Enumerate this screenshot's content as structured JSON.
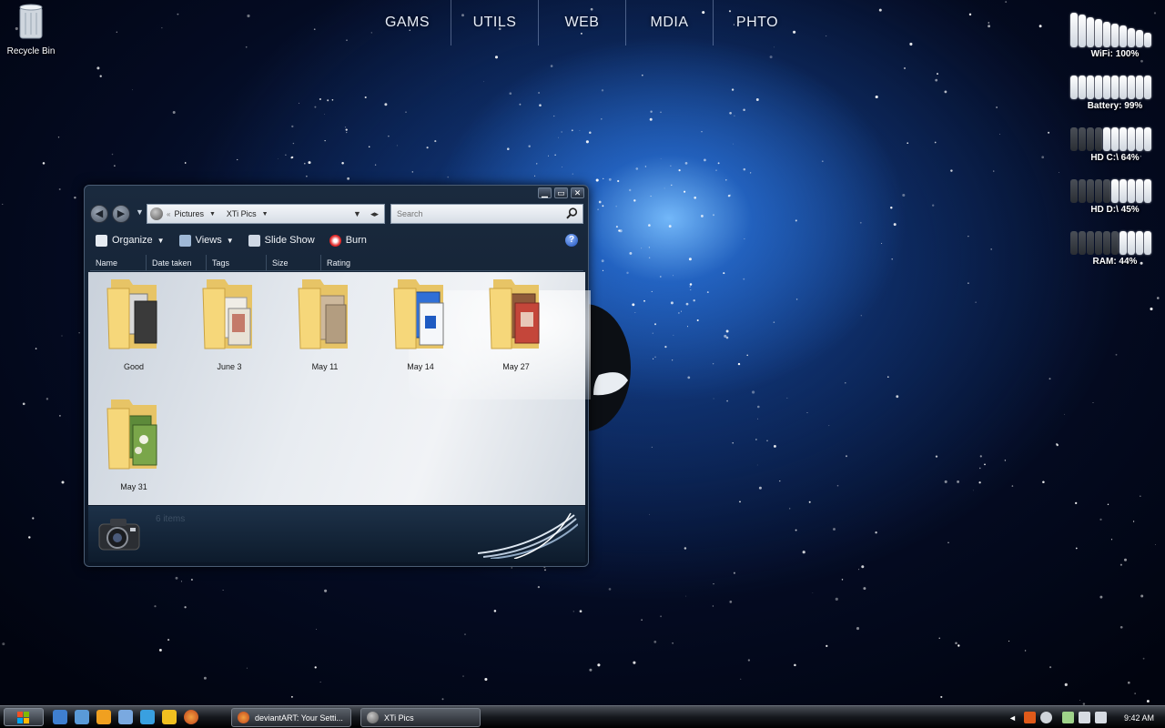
{
  "desktop": {
    "recycle_bin_label": "Recycle Bin"
  },
  "launcher": {
    "items": [
      "GAMS",
      "UTILS",
      "WEB",
      "MDIA",
      "PHTO"
    ]
  },
  "meters": [
    {
      "label": "WiFi: 100%",
      "value": 1.0
    },
    {
      "label": "Battery: 99%",
      "value": 0.99
    },
    {
      "label": "HD C:\\ 64%",
      "value": 0.64
    },
    {
      "label": "HD D:\\ 45%",
      "value": 0.45
    },
    {
      "label": "RAM: 44%",
      "value": 0.44
    }
  ],
  "explorer": {
    "address": {
      "segments": [
        "Pictures",
        "XTi Pics"
      ],
      "separator": "«"
    },
    "search_placeholder": "Search",
    "toolbar": {
      "organize": "Organize",
      "views": "Views",
      "slideshow": "Slide Show",
      "burn": "Burn",
      "help": "?"
    },
    "columns": [
      "Name",
      "Date taken",
      "Tags",
      "Size",
      "Rating"
    ],
    "folders": [
      {
        "name": "Good",
        "thumb": "bw-photos"
      },
      {
        "name": "June 3",
        "thumb": "documents"
      },
      {
        "name": "May 11",
        "thumb": "sepia-photos"
      },
      {
        "name": "May 14",
        "thumb": "psd-files"
      },
      {
        "name": "May 27",
        "thumb": "color-photos"
      },
      {
        "name": "May 31",
        "thumb": "flower-photos"
      }
    ],
    "details": {
      "count": "6 items"
    },
    "window_controls": [
      "minimize",
      "maximize",
      "close"
    ]
  },
  "taskbar": {
    "tasks": [
      {
        "label": "deviantART: Your Setti...",
        "icon": "firefox-icon",
        "color": "#e8701a"
      },
      {
        "label": "XTi Pics",
        "icon": "camera-folder-icon",
        "color": "#9aa0a8"
      }
    ],
    "quicklaunch": [
      {
        "icon": "show-desktop-icon",
        "color": "#3f7fd0"
      },
      {
        "icon": "switch-windows-icon",
        "color": "#5a9ad8"
      },
      {
        "icon": "media-player-icon",
        "color": "#f0a020"
      },
      {
        "icon": "calculator-icon",
        "color": "#7aa9e0"
      },
      {
        "icon": "hourglass-icon",
        "color": "#39a0e0"
      },
      {
        "icon": "runner-icon",
        "color": "#f0c020"
      },
      {
        "icon": "firefox-icon",
        "color": "#e8701a"
      }
    ],
    "tray_arrow": "◄",
    "tray_icons": [
      {
        "icon": "app-tray-icon",
        "color": "#e05a1a"
      },
      {
        "icon": "steam-icon",
        "color": "#cfd4da"
      },
      {
        "icon": "phone-icon",
        "color": "#9fd38a"
      },
      {
        "icon": "network-icon",
        "color": "#d6dbe2"
      },
      {
        "icon": "volume-icon",
        "color": "#d6dbe2"
      }
    ],
    "clock": "9:42 AM"
  }
}
